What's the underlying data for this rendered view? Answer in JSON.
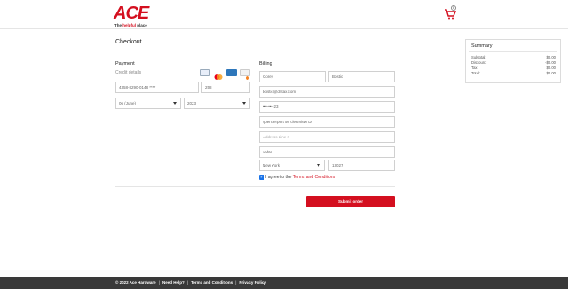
{
  "brand": {
    "logo_text": "ACE",
    "tagline_prefix": "The ",
    "tagline_highlight": "helpful",
    "tagline_suffix": " place",
    "accent_color": "#d40f1f"
  },
  "cart": {
    "count": "0",
    "icon": "shopping-cart-icon"
  },
  "page": {
    "title": "Checkout"
  },
  "payment": {
    "heading": "Payment",
    "credit_label": "Credit details",
    "card_icons": [
      "visa-card-icon",
      "mastercard-icon",
      "amex-card-icon",
      "discover-card-icon"
    ],
    "card_number": "4358-8290-0148 ****",
    "cvv": "258",
    "month": "06 (June)",
    "year": "2023"
  },
  "billing": {
    "heading": "Billing",
    "first_name": "Corey",
    "last_name": "Bostic",
    "email": "bostic@dntax.com",
    "phone": "•••-•••-23",
    "address1": "spencerport 50 clearview Dr",
    "address2_placeholder": "Address Line 2",
    "city": "sahta",
    "state": "New York",
    "zip": "13027"
  },
  "agree": {
    "prefix": "I agree to the ",
    "link": "Terms and Conditions"
  },
  "submit_label": "Submit order",
  "summary": {
    "title": "Summary",
    "rows": [
      {
        "label": "Subtotal:",
        "value": "$0.00"
      },
      {
        "label": "Discount:",
        "value": "-$0.00"
      },
      {
        "label": "Tax:",
        "value": "$0.00"
      },
      {
        "label": "Total:",
        "value": "$0.00"
      }
    ]
  },
  "footer": {
    "copyright": "© 2022 Ace Hardware",
    "help": "Need Help?",
    "terms": "Terms and Conditions",
    "privacy": "Privacy Policy"
  }
}
